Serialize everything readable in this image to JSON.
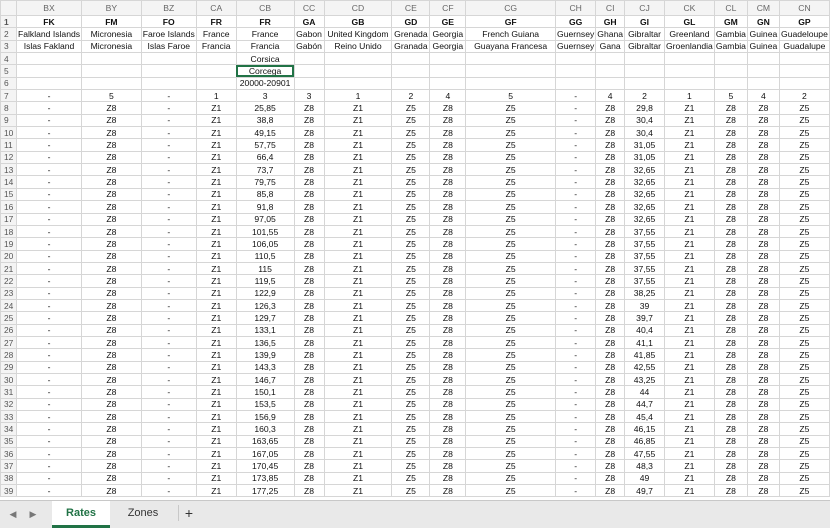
{
  "columns": [
    "BX",
    "BY",
    "BZ",
    "CA",
    "CB",
    "CC",
    "CD",
    "CE",
    "CF",
    "CG",
    "CH",
    "CI",
    "CJ",
    "CK",
    "CL",
    "CM",
    "CN"
  ],
  "selected_column": "CB",
  "rows": [
    {
      "n": "1",
      "c": [
        "FK",
        "FM",
        "FO",
        "FR",
        "FR",
        "GA",
        "GB",
        "GD",
        "GE",
        "GF",
        "GG",
        "GH",
        "GI",
        "GL",
        "GM",
        "GN",
        "GP"
      ]
    },
    {
      "n": "2",
      "c": [
        "Falkland Islands",
        "Micronesia",
        "Faroe Islands",
        "France",
        "France",
        "Gabon",
        "United Kingdom",
        "Grenada",
        "Georgia",
        "French Guiana",
        "Guernsey",
        "Ghana",
        "Gibraltar",
        "Greenland",
        "Gambia",
        "Guinea",
        "Guadeloupe"
      ]
    },
    {
      "n": "3",
      "c": [
        "Islas Fakland",
        "Micronesia",
        "Islas Faroe",
        "Francia",
        "Francia",
        "Gabón",
        "Reino Unido",
        "Granada",
        "Georgia",
        "Guayana Francesa",
        "Guernsey",
        "Gana",
        "Gibraltar",
        "Groenlandia",
        "Gambia",
        "Guinea",
        "Guadalupe"
      ]
    },
    {
      "n": "4",
      "c": [
        "",
        "",
        "",
        "",
        "Corsica",
        "",
        "",
        "",
        "",
        "",
        "",
        "",
        "",
        "",
        "",
        "",
        ""
      ]
    },
    {
      "n": "5",
      "c": [
        "",
        "",
        "",
        "",
        "Corcega",
        "",
        "",
        "",
        "",
        "",
        "",
        "",
        "",
        "",
        "",
        "",
        ""
      ]
    },
    {
      "n": "6",
      "c": [
        "",
        "",
        "",
        "",
        "20000-20901",
        "",
        "",
        "",
        "",
        "",
        "",
        "",
        "",
        "",
        "",
        "",
        ""
      ]
    },
    {
      "n": "7",
      "c": [
        "-",
        "5",
        "-",
        "1",
        "3",
        "3",
        "1",
        "2",
        "4",
        "5",
        "-",
        "4",
        "2",
        "1",
        "5",
        "4",
        "2"
      ]
    },
    {
      "n": "8",
      "c": [
        "-",
        "Z8",
        "-",
        "Z1",
        "25,85",
        "Z8",
        "Z1",
        "Z5",
        "Z8",
        "Z5",
        "-",
        "Z8",
        "29,8",
        "Z1",
        "Z8",
        "Z8",
        "Z5"
      ]
    },
    {
      "n": "9",
      "c": [
        "-",
        "Z8",
        "-",
        "Z1",
        "38,8",
        "Z8",
        "Z1",
        "Z5",
        "Z8",
        "Z5",
        "-",
        "Z8",
        "30,4",
        "Z1",
        "Z8",
        "Z8",
        "Z5"
      ]
    },
    {
      "n": "10",
      "c": [
        "-",
        "Z8",
        "-",
        "Z1",
        "49,15",
        "Z8",
        "Z1",
        "Z5",
        "Z8",
        "Z5",
        "-",
        "Z8",
        "30,4",
        "Z1",
        "Z8",
        "Z8",
        "Z5"
      ]
    },
    {
      "n": "11",
      "c": [
        "-",
        "Z8",
        "-",
        "Z1",
        "57,75",
        "Z8",
        "Z1",
        "Z5",
        "Z8",
        "Z5",
        "-",
        "Z8",
        "31,05",
        "Z1",
        "Z8",
        "Z8",
        "Z5"
      ]
    },
    {
      "n": "12",
      "c": [
        "-",
        "Z8",
        "-",
        "Z1",
        "66,4",
        "Z8",
        "Z1",
        "Z5",
        "Z8",
        "Z5",
        "-",
        "Z8",
        "31,05",
        "Z1",
        "Z8",
        "Z8",
        "Z5"
      ]
    },
    {
      "n": "13",
      "c": [
        "-",
        "Z8",
        "-",
        "Z1",
        "73,7",
        "Z8",
        "Z1",
        "Z5",
        "Z8",
        "Z5",
        "-",
        "Z8",
        "32,65",
        "Z1",
        "Z8",
        "Z8",
        "Z5"
      ]
    },
    {
      "n": "14",
      "c": [
        "-",
        "Z8",
        "-",
        "Z1",
        "79,75",
        "Z8",
        "Z1",
        "Z5",
        "Z8",
        "Z5",
        "-",
        "Z8",
        "32,65",
        "Z1",
        "Z8",
        "Z8",
        "Z5"
      ]
    },
    {
      "n": "15",
      "c": [
        "-",
        "Z8",
        "-",
        "Z1",
        "85,8",
        "Z8",
        "Z1",
        "Z5",
        "Z8",
        "Z5",
        "-",
        "Z8",
        "32,65",
        "Z1",
        "Z8",
        "Z8",
        "Z5"
      ]
    },
    {
      "n": "16",
      "c": [
        "-",
        "Z8",
        "-",
        "Z1",
        "91,8",
        "Z8",
        "Z1",
        "Z5",
        "Z8",
        "Z5",
        "-",
        "Z8",
        "32,65",
        "Z1",
        "Z8",
        "Z8",
        "Z5"
      ]
    },
    {
      "n": "17",
      "c": [
        "-",
        "Z8",
        "-",
        "Z1",
        "97,05",
        "Z8",
        "Z1",
        "Z5",
        "Z8",
        "Z5",
        "-",
        "Z8",
        "32,65",
        "Z1",
        "Z8",
        "Z8",
        "Z5"
      ]
    },
    {
      "n": "18",
      "c": [
        "-",
        "Z8",
        "-",
        "Z1",
        "101,55",
        "Z8",
        "Z1",
        "Z5",
        "Z8",
        "Z5",
        "-",
        "Z8",
        "37,55",
        "Z1",
        "Z8",
        "Z8",
        "Z5"
      ]
    },
    {
      "n": "19",
      "c": [
        "-",
        "Z8",
        "-",
        "Z1",
        "106,05",
        "Z8",
        "Z1",
        "Z5",
        "Z8",
        "Z5",
        "-",
        "Z8",
        "37,55",
        "Z1",
        "Z8",
        "Z8",
        "Z5"
      ]
    },
    {
      "n": "20",
      "c": [
        "-",
        "Z8",
        "-",
        "Z1",
        "110,5",
        "Z8",
        "Z1",
        "Z5",
        "Z8",
        "Z5",
        "-",
        "Z8",
        "37,55",
        "Z1",
        "Z8",
        "Z8",
        "Z5"
      ]
    },
    {
      "n": "21",
      "c": [
        "-",
        "Z8",
        "-",
        "Z1",
        "115",
        "Z8",
        "Z1",
        "Z5",
        "Z8",
        "Z5",
        "-",
        "Z8",
        "37,55",
        "Z1",
        "Z8",
        "Z8",
        "Z5"
      ]
    },
    {
      "n": "22",
      "c": [
        "-",
        "Z8",
        "-",
        "Z1",
        "119,5",
        "Z8",
        "Z1",
        "Z5",
        "Z8",
        "Z5",
        "-",
        "Z8",
        "37,55",
        "Z1",
        "Z8",
        "Z8",
        "Z5"
      ]
    },
    {
      "n": "23",
      "c": [
        "-",
        "Z8",
        "-",
        "Z1",
        "122,9",
        "Z8",
        "Z1",
        "Z5",
        "Z8",
        "Z5",
        "-",
        "Z8",
        "38,25",
        "Z1",
        "Z8",
        "Z8",
        "Z5"
      ]
    },
    {
      "n": "24",
      "c": [
        "-",
        "Z8",
        "-",
        "Z1",
        "126,3",
        "Z8",
        "Z1",
        "Z5",
        "Z8",
        "Z5",
        "-",
        "Z8",
        "39",
        "Z1",
        "Z8",
        "Z8",
        "Z5"
      ]
    },
    {
      "n": "25",
      "c": [
        "-",
        "Z8",
        "-",
        "Z1",
        "129,7",
        "Z8",
        "Z1",
        "Z5",
        "Z8",
        "Z5",
        "-",
        "Z8",
        "39,7",
        "Z1",
        "Z8",
        "Z8",
        "Z5"
      ]
    },
    {
      "n": "26",
      "c": [
        "-",
        "Z8",
        "-",
        "Z1",
        "133,1",
        "Z8",
        "Z1",
        "Z5",
        "Z8",
        "Z5",
        "-",
        "Z8",
        "40,4",
        "Z1",
        "Z8",
        "Z8",
        "Z5"
      ]
    },
    {
      "n": "27",
      "c": [
        "-",
        "Z8",
        "-",
        "Z1",
        "136,5",
        "Z8",
        "Z1",
        "Z5",
        "Z8",
        "Z5",
        "-",
        "Z8",
        "41,1",
        "Z1",
        "Z8",
        "Z8",
        "Z5"
      ]
    },
    {
      "n": "28",
      "c": [
        "-",
        "Z8",
        "-",
        "Z1",
        "139,9",
        "Z8",
        "Z1",
        "Z5",
        "Z8",
        "Z5",
        "-",
        "Z8",
        "41,85",
        "Z1",
        "Z8",
        "Z8",
        "Z5"
      ]
    },
    {
      "n": "29",
      "c": [
        "-",
        "Z8",
        "-",
        "Z1",
        "143,3",
        "Z8",
        "Z1",
        "Z5",
        "Z8",
        "Z5",
        "-",
        "Z8",
        "42,55",
        "Z1",
        "Z8",
        "Z8",
        "Z5"
      ]
    },
    {
      "n": "30",
      "c": [
        "-",
        "Z8",
        "-",
        "Z1",
        "146,7",
        "Z8",
        "Z1",
        "Z5",
        "Z8",
        "Z5",
        "-",
        "Z8",
        "43,25",
        "Z1",
        "Z8",
        "Z8",
        "Z5"
      ]
    },
    {
      "n": "31",
      "c": [
        "-",
        "Z8",
        "-",
        "Z1",
        "150,1",
        "Z8",
        "Z1",
        "Z5",
        "Z8",
        "Z5",
        "-",
        "Z8",
        "44",
        "Z1",
        "Z8",
        "Z8",
        "Z5"
      ]
    },
    {
      "n": "32",
      "c": [
        "-",
        "Z8",
        "-",
        "Z1",
        "153,5",
        "Z8",
        "Z1",
        "Z5",
        "Z8",
        "Z5",
        "-",
        "Z8",
        "44,7",
        "Z1",
        "Z8",
        "Z8",
        "Z5"
      ]
    },
    {
      "n": "33",
      "c": [
        "-",
        "Z8",
        "-",
        "Z1",
        "156,9",
        "Z8",
        "Z1",
        "Z5",
        "Z8",
        "Z5",
        "-",
        "Z8",
        "45,4",
        "Z1",
        "Z8",
        "Z8",
        "Z5"
      ]
    },
    {
      "n": "34",
      "c": [
        "-",
        "Z8",
        "-",
        "Z1",
        "160,3",
        "Z8",
        "Z1",
        "Z5",
        "Z8",
        "Z5",
        "-",
        "Z8",
        "46,15",
        "Z1",
        "Z8",
        "Z8",
        "Z5"
      ]
    },
    {
      "n": "35",
      "c": [
        "-",
        "Z8",
        "-",
        "Z1",
        "163,65",
        "Z8",
        "Z1",
        "Z5",
        "Z8",
        "Z5",
        "-",
        "Z8",
        "46,85",
        "Z1",
        "Z8",
        "Z8",
        "Z5"
      ]
    },
    {
      "n": "36",
      "c": [
        "-",
        "Z8",
        "-",
        "Z1",
        "167,05",
        "Z8",
        "Z1",
        "Z5",
        "Z8",
        "Z5",
        "-",
        "Z8",
        "47,55",
        "Z1",
        "Z8",
        "Z8",
        "Z5"
      ]
    },
    {
      "n": "37",
      "c": [
        "-",
        "Z8",
        "-",
        "Z1",
        "170,45",
        "Z8",
        "Z1",
        "Z5",
        "Z8",
        "Z5",
        "-",
        "Z8",
        "48,3",
        "Z1",
        "Z8",
        "Z8",
        "Z5"
      ]
    },
    {
      "n": "38",
      "c": [
        "-",
        "Z8",
        "-",
        "Z1",
        "173,85",
        "Z8",
        "Z1",
        "Z5",
        "Z8",
        "Z5",
        "-",
        "Z8",
        "49",
        "Z1",
        "Z8",
        "Z8",
        "Z5"
      ]
    },
    {
      "n": "39",
      "c": [
        "-",
        "Z8",
        "-",
        "Z1",
        "177,25",
        "Z8",
        "Z1",
        "Z5",
        "Z8",
        "Z5",
        "-",
        "Z8",
        "49,7",
        "Z1",
        "Z8",
        "Z8",
        "Z5"
      ]
    }
  ],
  "tabs": {
    "rates": "Rates",
    "zones": "Zones",
    "add": "+"
  },
  "icons": {
    "prev": "◀",
    "next": "▶"
  }
}
